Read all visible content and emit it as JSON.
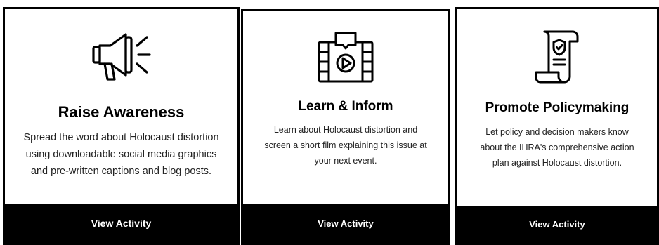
{
  "cards": [
    {
      "icon": "megaphone-icon",
      "title": "Raise Awareness",
      "lines": [
        "Spread the word about Holocaust distortion",
        "using downloadable social media graphics",
        "and pre-written captions and blog posts."
      ],
      "cta": "View Activity"
    },
    {
      "icon": "video-film-icon",
      "title": "Learn & Inform",
      "lines": [
        "Learn about Holocaust distortion and",
        "screen a short film explaining this issue at",
        "your next event."
      ],
      "cta": "View Activity"
    },
    {
      "icon": "policy-scroll-icon",
      "title": "Promote Policymaking",
      "lines": [
        "Let policy and decision makers know",
        "about the IHRA's comprehensive action",
        "plan against Holocaust distortion."
      ],
      "cta": "View Activity"
    }
  ]
}
